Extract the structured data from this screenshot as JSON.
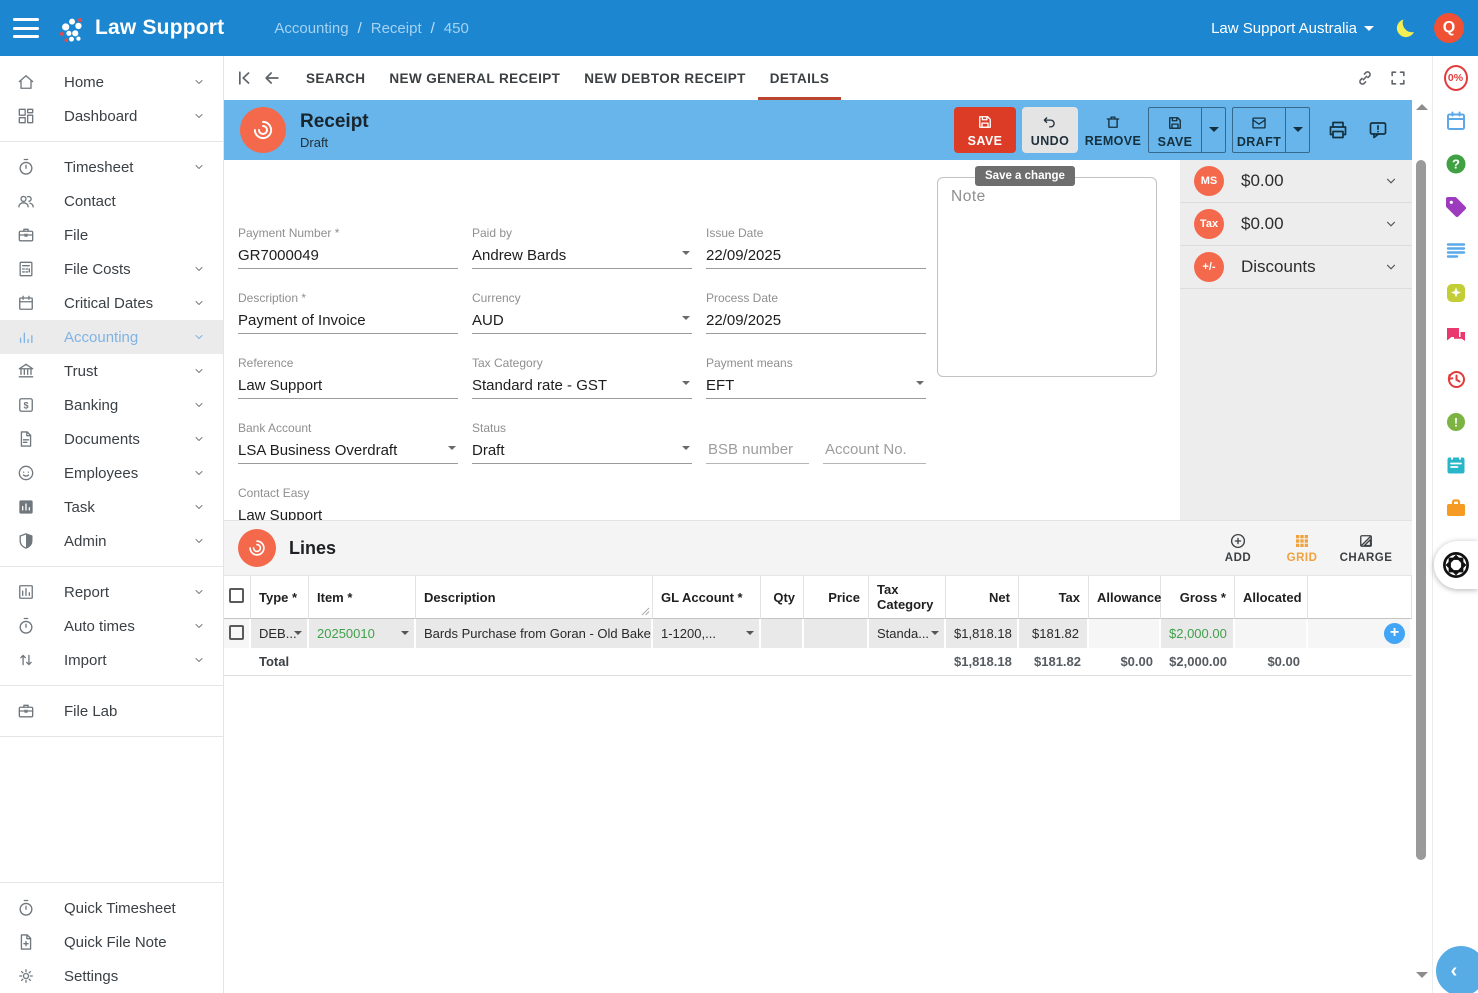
{
  "colors": {
    "navbar_blue": "#1c86d1",
    "header_blue": "#67b5ea",
    "accent_coral": "#f4694c",
    "save_red": "#dc3b26",
    "active_tab_underline": "#b9452e",
    "active_nav_blue": "#7fb3e6",
    "value_green": "#3fa14a",
    "grid_active_orange": "#efa23d",
    "add_row_blue": "#42a5f5"
  },
  "topbar": {
    "brand": "Law Support",
    "breadcrumb": {
      "items": [
        "Accounting",
        "Receipt",
        "450"
      ],
      "separator": "/"
    },
    "tenant": "Law Support Australia",
    "avatar_initial": "Q"
  },
  "tabbar": {
    "tabs": [
      {
        "label": "SEARCH"
      },
      {
        "label": "NEW GENERAL RECEIPT"
      },
      {
        "label": "NEW DEBTOR RECEIPT"
      },
      {
        "label": "DETAILS",
        "active": true
      }
    ]
  },
  "header": {
    "title": "Receipt",
    "subtitle": "Draft",
    "save_label": "SAVE",
    "undo_label": "UNDO",
    "remove_label": "REMOVE",
    "save_menu_label": "SAVE",
    "draft_menu_label": "DRAFT",
    "tooltip": "Save a change"
  },
  "form": {
    "payment_number": {
      "label": "Payment Number *",
      "value": "GR7000049"
    },
    "paid_by": {
      "label": "Paid by",
      "value": "Andrew Bards"
    },
    "issue_date": {
      "label": "Issue Date",
      "value": "22/09/2025"
    },
    "description": {
      "label": "Description *",
      "value": "Payment of Invoice"
    },
    "currency": {
      "label": "Currency",
      "value": "AUD"
    },
    "process_date": {
      "label": "Process Date",
      "value": "22/09/2025"
    },
    "reference": {
      "label": "Reference",
      "value": "Law Support"
    },
    "tax_category": {
      "label": "Tax Category",
      "value": "Standard rate - GST"
    },
    "payment_means": {
      "label": "Payment means",
      "value": "EFT"
    },
    "bank_account": {
      "label": "Bank Account",
      "value": "LSA Business Overdraft"
    },
    "status": {
      "label": "Status",
      "value": "Draft"
    },
    "bsb": {
      "placeholder": "BSB number"
    },
    "account_no": {
      "placeholder": "Account No."
    },
    "contact_easy": {
      "label": "Contact Easy",
      "value": "Law Support"
    },
    "note_placeholder": "Note"
  },
  "summary": {
    "items": [
      {
        "badge": "MS",
        "label": "$0.00"
      },
      {
        "badge": "Tax",
        "label": "$0.00"
      },
      {
        "badge": "+/-",
        "label": "Discounts"
      }
    ]
  },
  "lines": {
    "title": "Lines",
    "actions": {
      "add": "ADD",
      "grid": "GRID",
      "charge": "CHARGE"
    },
    "columns": [
      "Type *",
      "Item *",
      "Description",
      "GL Account *",
      "Qty",
      "Price",
      "Tax Category",
      "Net",
      "Tax",
      "Allowance",
      "Gross *",
      "Allocated"
    ],
    "row": {
      "type": "DEB...",
      "item": "20250010",
      "description": "Bards Purchase from Goran - Old Bakersv",
      "gl_account": "1-1200,...",
      "qty": "",
      "price": "",
      "tax_category": "Standa...",
      "net": "$1,818.18",
      "tax": "$181.82",
      "allowance": "",
      "gross": "$2,000.00",
      "allocated": ""
    },
    "total": {
      "label": "Total",
      "net": "$1,818.18",
      "tax": "$181.82",
      "allowance": "$0.00",
      "gross": "$2,000.00",
      "allocated": "$0.00"
    }
  },
  "sidebar": {
    "items": [
      {
        "label": "Home",
        "icon": "home",
        "expandable": true
      },
      {
        "label": "Dashboard",
        "icon": "dashboard",
        "expandable": true
      },
      {
        "label": "Timesheet",
        "icon": "stopwatch",
        "expandable": true
      },
      {
        "label": "Contact",
        "icon": "people",
        "expandable": false
      },
      {
        "label": "File",
        "icon": "briefcase",
        "expandable": false
      },
      {
        "label": "File Costs",
        "icon": "calculator",
        "expandable": true
      },
      {
        "label": "Critical Dates",
        "icon": "calendar",
        "expandable": true
      },
      {
        "label": "Accounting",
        "icon": "bar-chart",
        "expandable": true,
        "active": true
      },
      {
        "label": "Trust",
        "icon": "bank",
        "expandable": true
      },
      {
        "label": "Banking",
        "icon": "dollar-square",
        "expandable": true
      },
      {
        "label": "Documents",
        "icon": "document",
        "expandable": true
      },
      {
        "label": "Employees",
        "icon": "face",
        "expandable": true
      },
      {
        "label": "Task",
        "icon": "bar-chart-filled",
        "expandable": true
      },
      {
        "label": "Admin",
        "icon": "shield",
        "expandable": true
      },
      {
        "label": "Report",
        "icon": "report-chart",
        "expandable": true
      },
      {
        "label": "Auto times",
        "icon": "stopwatch",
        "expandable": true
      },
      {
        "label": "Import",
        "icon": "up-down-arrows",
        "expandable": true
      },
      {
        "label": "File Lab",
        "icon": "briefcase",
        "expandable": false
      },
      {
        "label": "Quick Timesheet",
        "icon": "stopwatch",
        "expandable": false
      },
      {
        "label": "Quick File Note",
        "icon": "document-plus",
        "expandable": false
      },
      {
        "label": "Settings",
        "icon": "gear",
        "expandable": false
      }
    ]
  },
  "right_strip": {
    "badge": "0%",
    "icons": [
      "discount-percent",
      "calendar",
      "help",
      "tag",
      "notes-lines",
      "sparkle-badge",
      "chat-bubbles",
      "history-clock",
      "alert-seal",
      "notebook",
      "briefcase",
      "knot-logo",
      "collapse-panel"
    ]
  }
}
